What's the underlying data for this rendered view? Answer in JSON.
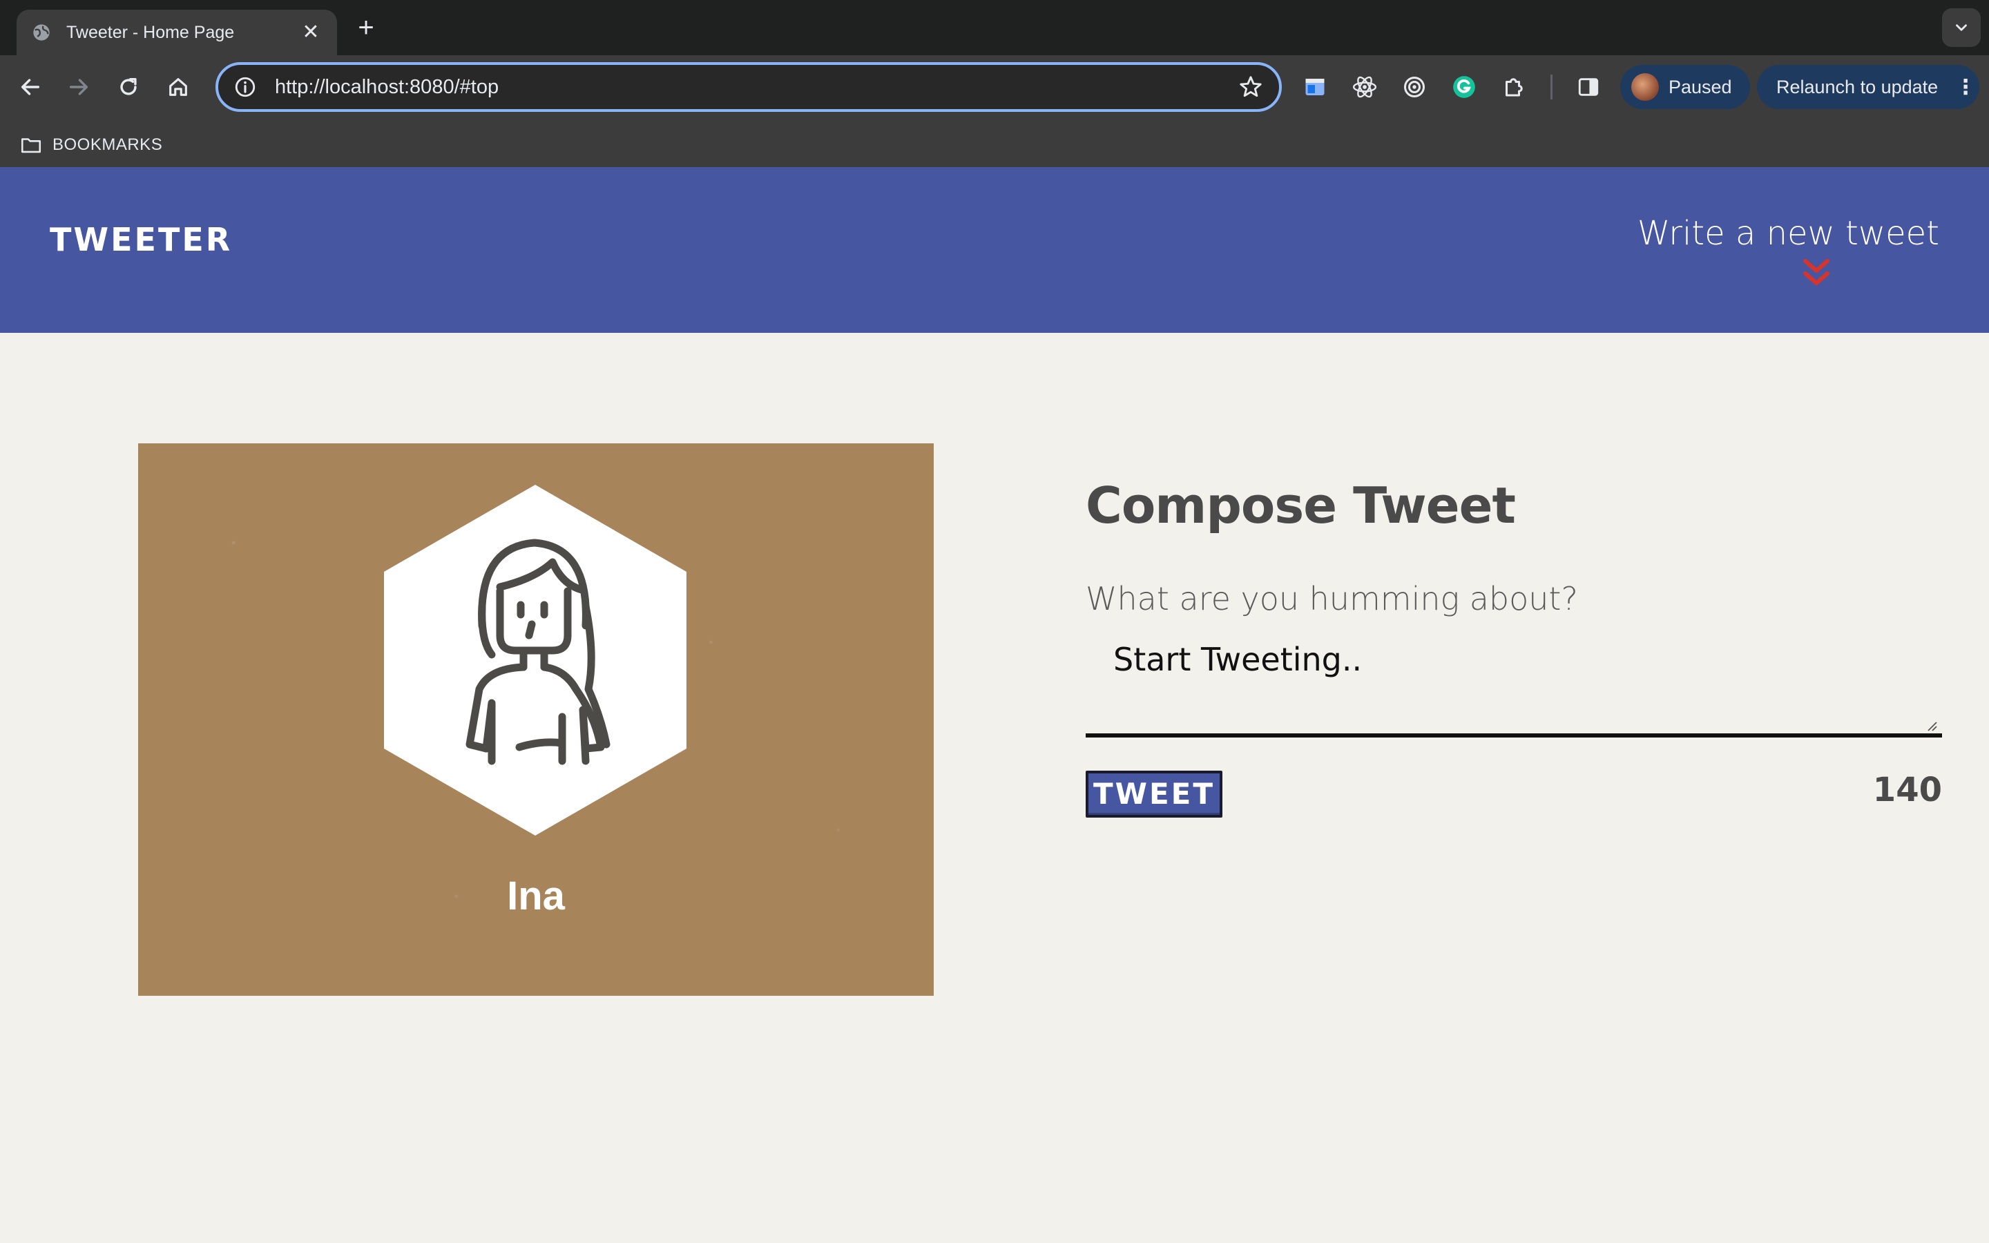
{
  "browser": {
    "tab": {
      "title": "Tweeter - Home Page",
      "close_label": "✕"
    },
    "new_tab_label": "+",
    "address_bar": {
      "url": "http://localhost:8080/#top"
    },
    "profile": {
      "label": "Paused"
    },
    "relaunch": {
      "label": "Relaunch to update",
      "menu_label": "⋮"
    },
    "bookmarks_bar": {
      "folder_label": "BOOKMARKS"
    },
    "extensions": [
      "window-extension-icon",
      "react-devtools-icon",
      "target-extension-icon",
      "grammarly-icon",
      "puzzle-extensions-icon",
      "side-panel-icon"
    ]
  },
  "site": {
    "logo": "TWEETER",
    "nav_link": "Write a new tweet",
    "accent_color": "#4656a0",
    "chevron_color": "#d9342b"
  },
  "profile_card": {
    "name": "Ina",
    "avatar_icon": "female-user-avatar-icon",
    "background_color": "#a8845a"
  },
  "compose": {
    "title": "Compose Tweet",
    "label": "What are you humming about?",
    "placeholder": "Start Tweeting..",
    "submit_label": "TWEET",
    "char_counter": "140"
  }
}
